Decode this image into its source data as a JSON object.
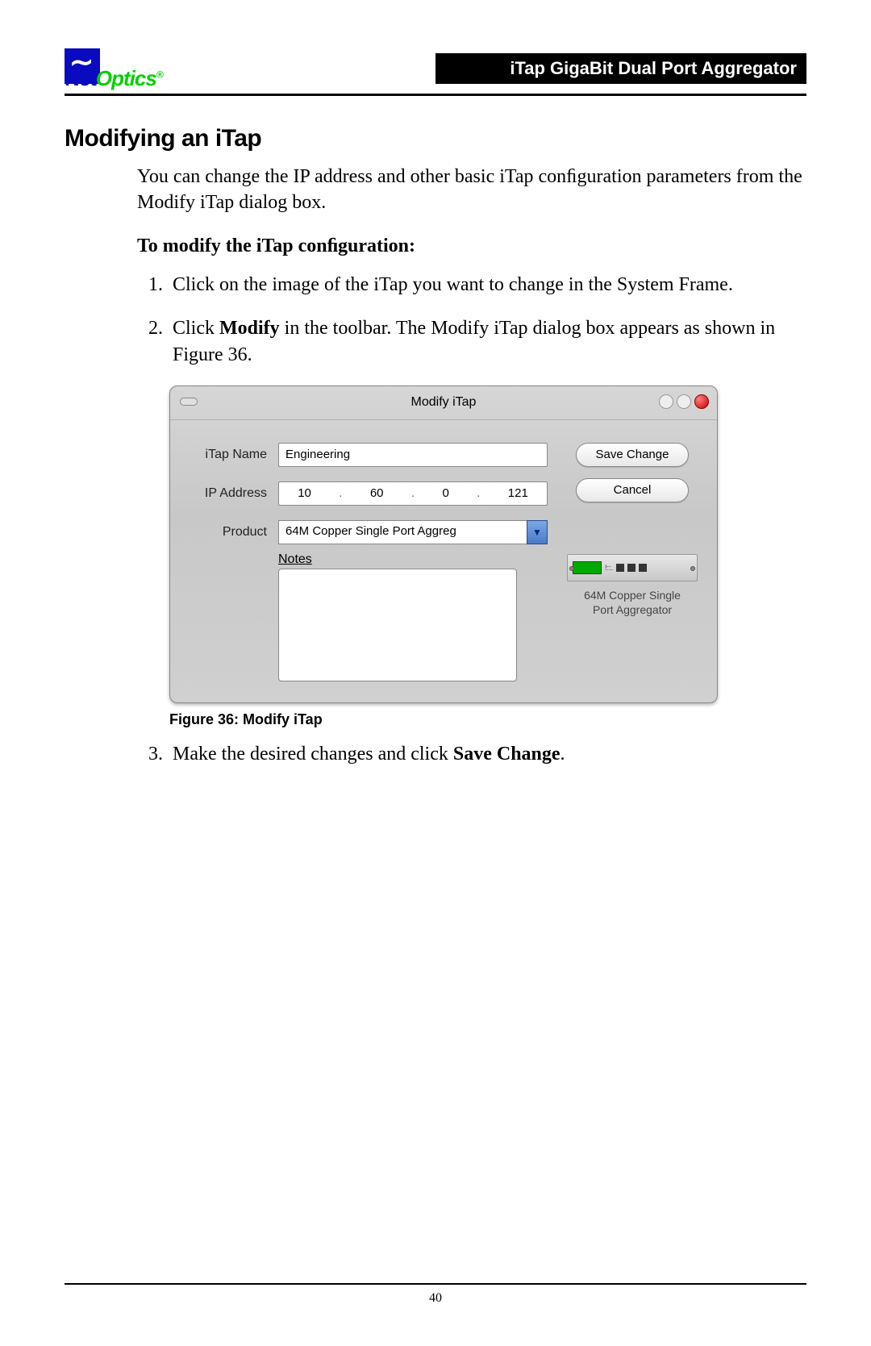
{
  "header": {
    "logo_net": "Net",
    "logo_optics": "Optics",
    "logo_reg": "®",
    "doc_title": "iTap GigaBit Dual Port Aggregator"
  },
  "section_title": "Modifying an iTap",
  "intro": "You can change the IP address and other basic iTap conﬁguration parameters from the Modify iTap dialog box.",
  "subhead": "To modify the iTap conﬁguration:",
  "steps": {
    "s1": "Click on the image of the iTap you want to change in the System Frame.",
    "s2_pre": "Click ",
    "s2_bold": "Modify",
    "s2_post": " in the toolbar. The Modify iTap dialog box appears as shown in Figure 36.",
    "s3_pre": "Make the desired changes and click ",
    "s3_bold": "Save Change",
    "s3_post": "."
  },
  "dialog": {
    "title": "Modify iTap",
    "labels": {
      "name": "iTap Name",
      "ip": "IP Address",
      "product": "Product",
      "notes": "Notes"
    },
    "name_value": "Engineering",
    "ip": {
      "a": "10",
      "b": "60",
      "c": "0",
      "d": "121"
    },
    "product_value": "64M Copper Single Port Aggreg",
    "buttons": {
      "save": "Save Change",
      "cancel": "Cancel"
    },
    "device_caption_l1": "64M Copper Single",
    "device_caption_l2": "Port Aggregator"
  },
  "figure_caption_label": "Figure 36: ",
  "figure_caption_text": "Modify iTap",
  "page_number": "40"
}
